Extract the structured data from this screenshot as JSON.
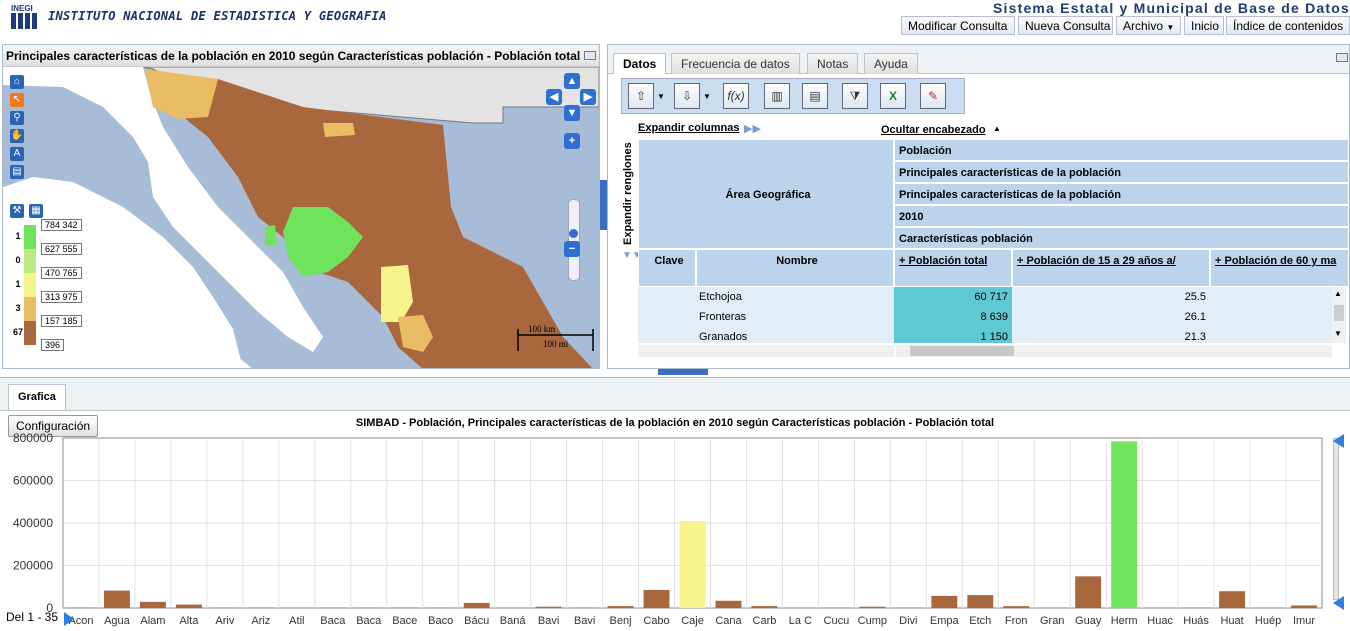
{
  "header": {
    "logo_text": "INEGI",
    "institute": "INSTITUTO NACIONAL DE ESTADISTICA Y GEOGRAFIA",
    "system_title": "Sistema Estatal y Municipal de Base de Datos",
    "buttons": [
      "Modificar Consulta",
      "Nueva Consulta",
      "Archivo",
      "Inicio",
      "Índice de contenidos"
    ]
  },
  "map": {
    "title": "Principales características de la población en 2010 según Características población - Población total",
    "legend": [
      {
        "count": "1",
        "value": "784 342",
        "color": "#6fe35b"
      },
      {
        "count": "0",
        "value": "627 555",
        "color": "#b9ea86"
      },
      {
        "count": "1",
        "value": "470 765",
        "color": "#f6f38a"
      },
      {
        "count": "3",
        "value": "313 975",
        "color": "#e8bd64"
      },
      {
        "count": "67",
        "value": "157 185",
        "color": "#a8673c"
      },
      {
        "count": "",
        "value": "396",
        "color": "#a8673c"
      }
    ],
    "scale_km": "100 km",
    "scale_mi": "100 mi"
  },
  "data_panel": {
    "tabs": [
      "Datos",
      "Frecuencia de datos",
      "Notas",
      "Ayuda"
    ],
    "expand_columns": "Expandir columnas",
    "hide_header": "Ocultar encabezado",
    "expand_rows": "Expandir renglones",
    "area_header": "Área Geográfica",
    "header_rows": [
      "Población",
      "Principales características de la población",
      "Principales características de la población",
      "2010",
      "Características población"
    ],
    "col_clave": "Clave",
    "col_nombre": "Nombre",
    "col_1": "Población total",
    "col_2": "Población de 15 a 29 años a/",
    "col_3": "Población de 60 y ma",
    "rows": [
      {
        "nombre": "Etchojoa",
        "total": "60 717",
        "p15": "25.5"
      },
      {
        "nombre": "Fronteras",
        "total": "8 639",
        "p15": "26.1"
      },
      {
        "nombre": "Granados",
        "total": "1 150",
        "p15": "21.3"
      }
    ]
  },
  "chart_panel": {
    "tab": "Grafica",
    "config_button": "Configuración",
    "range_label": "Del 1 - 35"
  },
  "chart_data": {
    "type": "bar",
    "title": "SIMBAD - Población, Principales características de la población en 2010 según Características población - Población total",
    "ylim": [
      0,
      800000
    ],
    "yticks": [
      "0",
      "200000",
      "400000",
      "600000",
      "800000"
    ],
    "categories": [
      "Acon",
      "Agua",
      "Alam",
      "Alta",
      "Ariv",
      "Ariz",
      "Atil",
      "Baca",
      "Baca",
      "Bace",
      "Baco",
      "Bácu",
      "Baná",
      "Bavi",
      "Bavi",
      "Benj",
      "Cabo",
      "Caje",
      "Cana",
      "Carb",
      "La C",
      "Cucu",
      "Cump",
      "Divi",
      "Empa",
      "Etch",
      "Fron",
      "Gran",
      "Guay",
      "Herm",
      "Huac",
      "Huás",
      "Huat",
      "Huép",
      "Imur"
    ],
    "values": [
      2000,
      82000,
      29000,
      16000,
      1500,
      2000,
      1000,
      1500,
      1500,
      2000,
      1500,
      24000,
      1000,
      6000,
      2000,
      9000,
      85000,
      409000,
      34000,
      9000,
      1000,
      1500,
      6000,
      1500,
      57000,
      60717,
      8639,
      1150,
      149000,
      784342,
      1000,
      1500,
      79000,
      1000,
      12000
    ],
    "colors": [
      "#a8673c",
      "#a8673c",
      "#a8673c",
      "#a8673c",
      "#a8673c",
      "#a8673c",
      "#a8673c",
      "#a8673c",
      "#a8673c",
      "#a8673c",
      "#a8673c",
      "#a8673c",
      "#a8673c",
      "#a8673c",
      "#a8673c",
      "#a8673c",
      "#a8673c",
      "#f6f38a",
      "#a8673c",
      "#a8673c",
      "#a8673c",
      "#a8673c",
      "#a8673c",
      "#a8673c",
      "#a8673c",
      "#a8673c",
      "#a8673c",
      "#a8673c",
      "#a8673c",
      "#6fe35b",
      "#a8673c",
      "#a8673c",
      "#a8673c",
      "#a8673c",
      "#a8673c"
    ],
    "grid": true
  }
}
